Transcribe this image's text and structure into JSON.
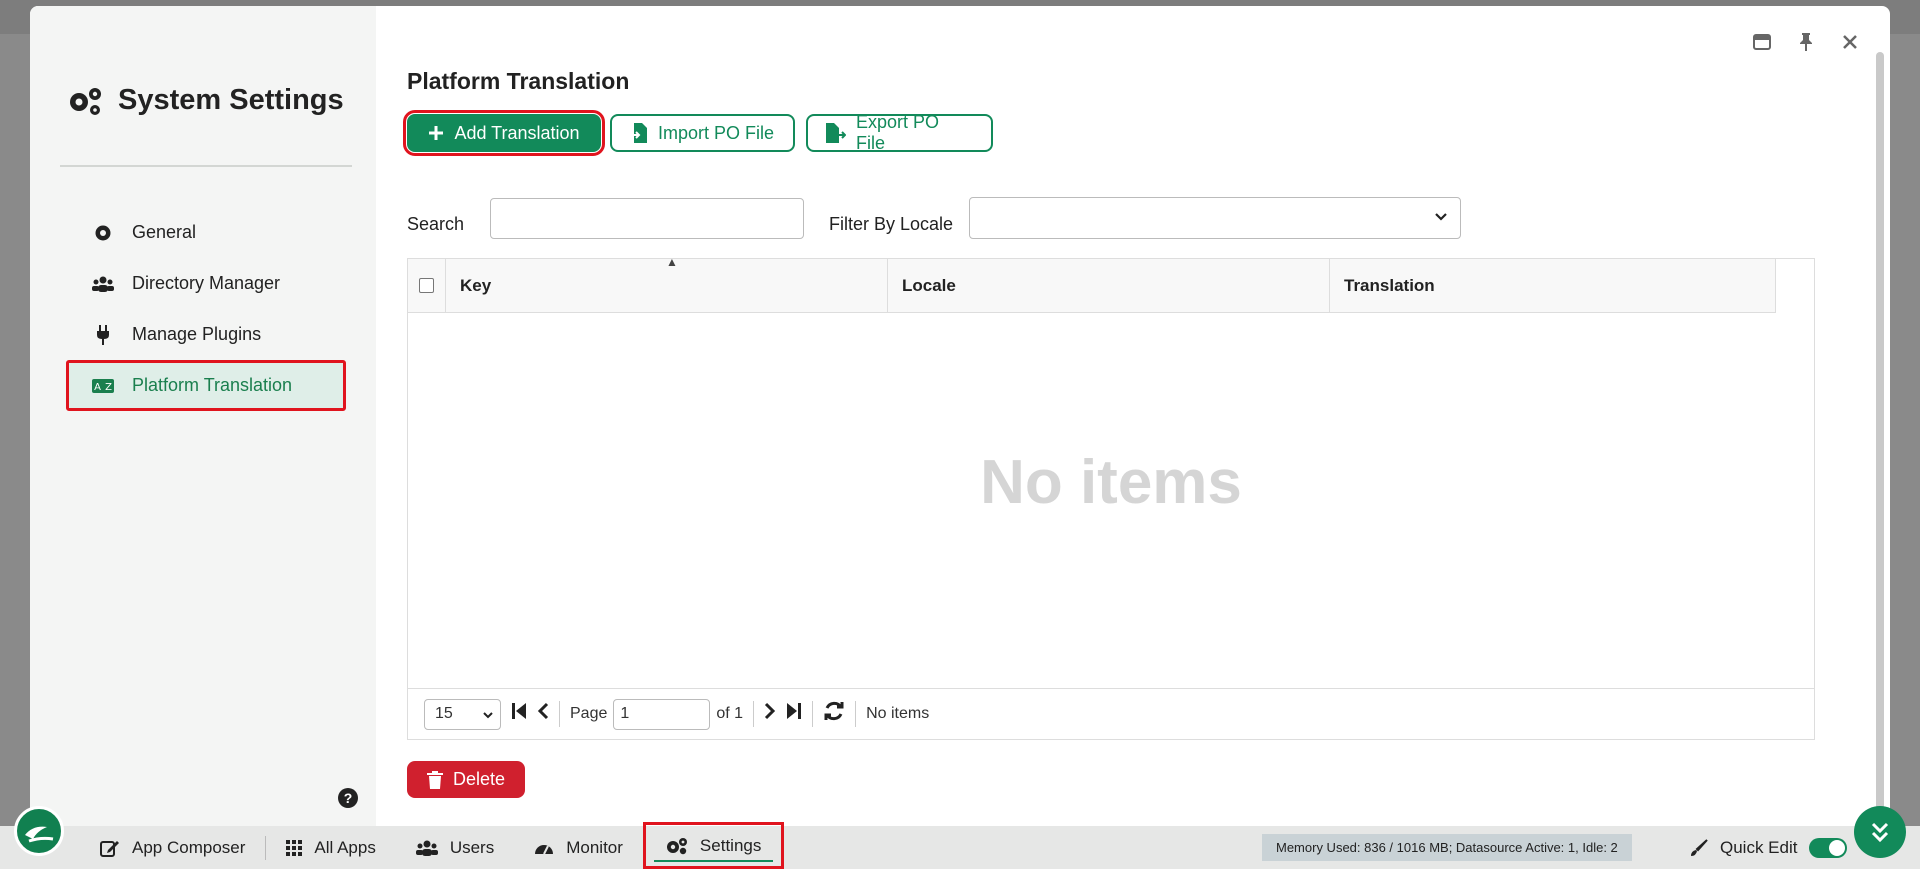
{
  "sidebar": {
    "title": "System Settings",
    "items": [
      {
        "label": "General",
        "icon": "gear-icon"
      },
      {
        "label": "Directory Manager",
        "icon": "users-icon"
      },
      {
        "label": "Manage Plugins",
        "icon": "plug-icon"
      },
      {
        "label": "Platform Translation",
        "icon": "translate-icon"
      }
    ],
    "help": "?"
  },
  "main": {
    "title": "Platform Translation",
    "buttons": {
      "add": "Add Translation",
      "import": "Import PO File",
      "export": "Export PO File",
      "delete": "Delete"
    },
    "search_label": "Search",
    "filter_label": "Filter By Locale",
    "grid": {
      "columns": [
        "Key",
        "Locale",
        "Translation"
      ],
      "empty_text": "No items"
    },
    "pager": {
      "page_size": "15",
      "page_label": "Page",
      "page_value": "1",
      "of_label": "of 1",
      "status": "No items"
    }
  },
  "taskbar": {
    "items": [
      "App Composer",
      "All Apps",
      "Users",
      "Monitor",
      "Settings"
    ],
    "memory": "Memory Used: 836 / 1016 MB; Datasource Active: 1, Idle: 2",
    "quick_edit": "Quick Edit"
  },
  "colors": {
    "accent": "#128a5a",
    "danger": "#d0202e",
    "highlight": "#e0141e"
  }
}
